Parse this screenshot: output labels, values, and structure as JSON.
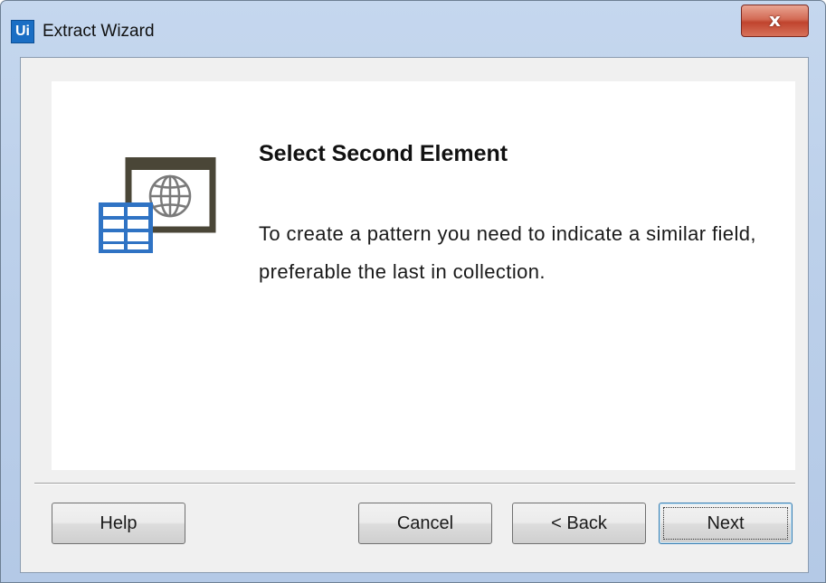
{
  "window": {
    "title": "Extract Wizard",
    "app_icon_text": "Ui",
    "close_symbol": "x"
  },
  "wizard": {
    "heading": "Select Second Element",
    "description": "To create a pattern you need to indicate a similar field, preferable the last in collection.",
    "icon": "extract-structured-data-icon"
  },
  "buttons": {
    "help": "Help",
    "cancel": "Cancel",
    "back": "< Back",
    "next": "Next"
  },
  "colors": {
    "accent_blue": "#2f73c4",
    "icon_frame": "#4a4637",
    "close_red": "#c7452f"
  }
}
